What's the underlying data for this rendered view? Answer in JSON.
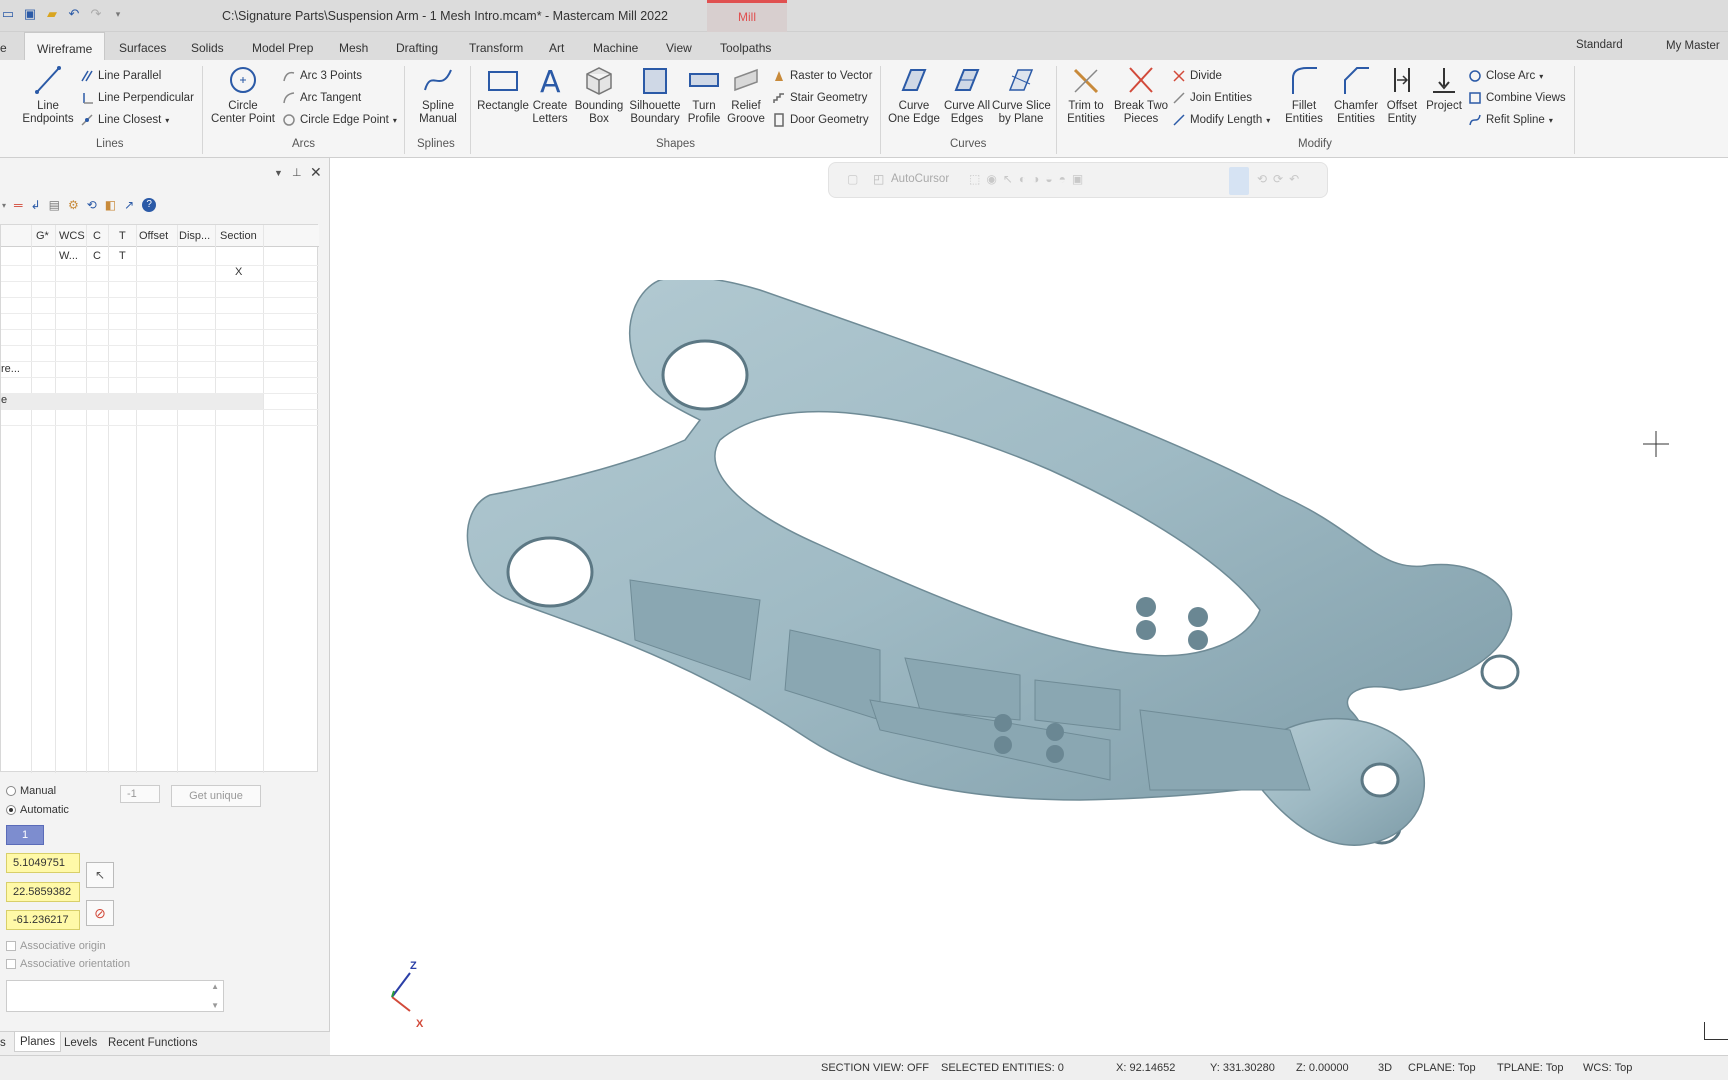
{
  "window": {
    "title": "C:\\Signature Parts\\Suspension Arm - 1 Mesh Intro.mcam* - Mastercam Mill 2022",
    "context_tab": "Mill"
  },
  "ribbon_tabs": [
    {
      "label": "e"
    },
    {
      "label": "Wireframe"
    },
    {
      "label": "Surfaces"
    },
    {
      "label": "Solids"
    },
    {
      "label": "Model Prep"
    },
    {
      "label": "Mesh"
    },
    {
      "label": "Drafting"
    },
    {
      "label": "Transform"
    },
    {
      "label": "Art"
    },
    {
      "label": "Machine"
    },
    {
      "label": "View"
    },
    {
      "label": "Toolpaths"
    }
  ],
  "workspace": {
    "standard": "Standard",
    "my_mastercam": "My Master"
  },
  "ribbon": {
    "lines": {
      "group": "Lines",
      "line_endpoints": "Line\nEndpoints",
      "line_parallel": "Line Parallel",
      "line_perpendicular": "Line Perpendicular",
      "line_closest": "Line Closest"
    },
    "arcs": {
      "group": "Arcs",
      "circle_center_point": "Circle\nCenter Point",
      "arc_3_points": "Arc 3 Points",
      "arc_tangent": "Arc Tangent",
      "circle_edge_point": "Circle Edge Point"
    },
    "splines": {
      "group": "Splines",
      "spline_manual": "Spline\nManual"
    },
    "shapes": {
      "group": "Shapes",
      "rectangle": "Rectangle",
      "create_letters": "Create\nLetters",
      "bounding_box": "Bounding\nBox",
      "silhouette_boundary": "Silhouette\nBoundary",
      "turn_profile": "Turn\nProfile",
      "relief_groove": "Relief\nGroove",
      "raster_to_vector": "Raster to Vector",
      "stair_geometry": "Stair Geometry",
      "door_geometry": "Door Geometry"
    },
    "curves": {
      "group": "Curves",
      "curve_one_edge": "Curve\nOne Edge",
      "curve_all_edges": "Curve All\nEdges",
      "curve_slice_by_plane": "Curve Slice\nby Plane"
    },
    "modify": {
      "group": "Modify",
      "trim_to_entities": "Trim to\nEntities",
      "break_two_pieces": "Break Two\nPieces",
      "divide": "Divide",
      "join_entities": "Join Entities",
      "modify_length": "Modify Length",
      "fillet_entities": "Fillet\nEntities",
      "chamfer_entities": "Chamfer\nEntities",
      "offset_entity": "Offset\nEntity",
      "project": "Project",
      "close_arc": "Close Arc",
      "combine_views": "Combine Views",
      "refit_spline": "Refit Spline"
    }
  },
  "planes_grid": {
    "headers": [
      "G*",
      "WCS",
      "C",
      "T",
      "Offset",
      "Disp...",
      "Section"
    ],
    "row1": {
      "wcs": "W...",
      "c": "C",
      "t": "T"
    },
    "row2": {
      "section": "X"
    },
    "truncated_row": "re...",
    "truncated_row2": "e"
  },
  "origin_panel": {
    "manual": "Manual",
    "automatic": "Automatic",
    "number_value": "-1",
    "get_unique": "Get unique",
    "plane_number": "1",
    "x": "5.1049751",
    "y": "22.5859382",
    "z": "-61.236217",
    "associative_origin": "Associative origin",
    "associative_orientation": "Associative orientation"
  },
  "bottom_tabs": [
    "s",
    "Planes",
    "Levels",
    "Recent Functions"
  ],
  "viewport": {
    "autocursor": "AutoCursor",
    "axis_z": "Z",
    "axis_x": "X"
  },
  "status": {
    "section_view": "SECTION VIEW: OFF",
    "selected": "SELECTED ENTITIES: 0",
    "x": "X:  92.14652",
    "y": "Y:  331.30280",
    "z": "Z:  0.00000",
    "mode": "3D",
    "cplane": "CPLANE: Top",
    "tplane": "TPLANE: Top",
    "wcs": "WCS: Top"
  },
  "colors": {
    "accent": "#2b5aa7",
    "part": "#9fbac4",
    "context": "#e05050",
    "input_highlight": "#fff9a8"
  }
}
